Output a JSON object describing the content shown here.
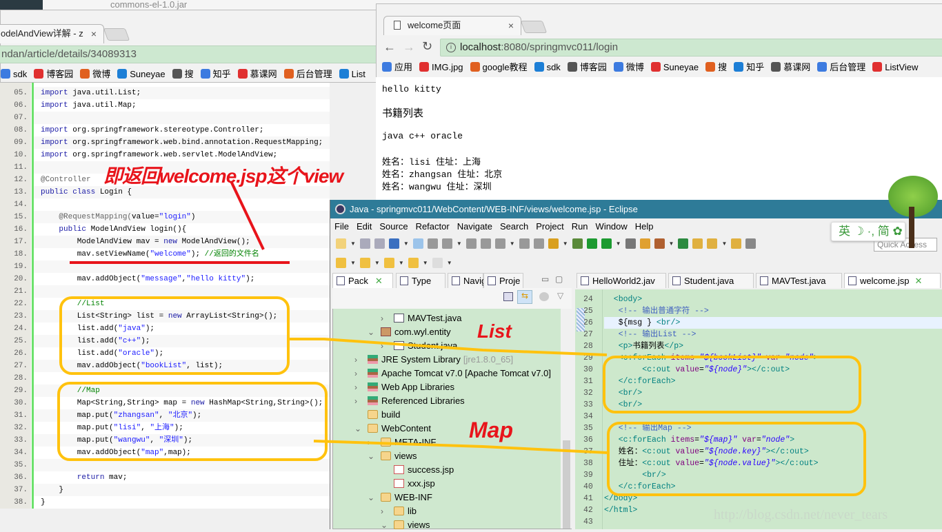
{
  "explorer_strip": {
    "title": "commons-el-1.0.jar"
  },
  "left_browser": {
    "tab_title": "odelAndView详解 - z",
    "tab_close": "×",
    "url": "ndan/article/details/34089313",
    "bookmarks": [
      "sdk",
      "博客园",
      "微博",
      "Suneyae",
      "搜",
      "知乎",
      "慕课网",
      "后台管理",
      "List"
    ]
  },
  "code": {
    "lines": [
      {
        "n": "05.",
        "seg": [
          [
            "import",
            "k"
          ],
          [
            " java.util.List;",
            ""
          ]
        ]
      },
      {
        "n": "06.",
        "seg": [
          [
            "import",
            "k"
          ],
          [
            " java.util.Map;",
            ""
          ]
        ]
      },
      {
        "n": "07.",
        "seg": []
      },
      {
        "n": "08.",
        "seg": [
          [
            "import",
            "k"
          ],
          [
            " org.springframework.stereotype.Controller;",
            ""
          ]
        ]
      },
      {
        "n": "09.",
        "seg": [
          [
            "import",
            "k"
          ],
          [
            " org.springframework.web.bind.annotation.RequestMapping;",
            ""
          ]
        ]
      },
      {
        "n": "10.",
        "seg": [
          [
            "import",
            "k"
          ],
          [
            " org.springframework.web.servlet.ModelAndView;",
            ""
          ]
        ]
      },
      {
        "n": "11.",
        "seg": []
      },
      {
        "n": "12.",
        "seg": [
          [
            "@Controller",
            "a"
          ]
        ]
      },
      {
        "n": "13.",
        "seg": [
          [
            "public class",
            "k"
          ],
          [
            " Login {",
            ""
          ]
        ]
      },
      {
        "n": "14.",
        "seg": []
      },
      {
        "n": "15.",
        "seg": [
          [
            "    @RequestMapping(",
            "a"
          ],
          [
            "value=",
            ""
          ],
          [
            "\"login\"",
            "s"
          ],
          [
            ")",
            ""
          ]
        ]
      },
      {
        "n": "16.",
        "seg": [
          [
            "    public",
            "k"
          ],
          [
            " ModelAndView login(){",
            ""
          ]
        ]
      },
      {
        "n": "17.",
        "seg": [
          [
            "        ModelAndView mav = ",
            ""
          ],
          [
            "new",
            "k"
          ],
          [
            " ModelAndView();",
            ""
          ]
        ]
      },
      {
        "n": "18.",
        "seg": [
          [
            "        mav.setViewName(",
            ""
          ],
          [
            "\"welcome\"",
            "s"
          ],
          [
            "); ",
            ""
          ],
          [
            "//返回的文件名",
            "c"
          ]
        ]
      },
      {
        "n": "19.",
        "seg": []
      },
      {
        "n": "20.",
        "seg": [
          [
            "        mav.addObject(",
            ""
          ],
          [
            "\"message\"",
            "s"
          ],
          [
            ",",
            ""
          ],
          [
            "\"hello kitty\"",
            "s"
          ],
          [
            ");",
            ""
          ]
        ]
      },
      {
        "n": "21.",
        "seg": []
      },
      {
        "n": "22.",
        "seg": [
          [
            "        //List",
            "c"
          ]
        ]
      },
      {
        "n": "23.",
        "seg": [
          [
            "        List<String> list = ",
            ""
          ],
          [
            "new",
            "k"
          ],
          [
            " ArrayList<String>();",
            ""
          ]
        ]
      },
      {
        "n": "24.",
        "seg": [
          [
            "        list.add(",
            ""
          ],
          [
            "\"java\"",
            "s"
          ],
          [
            ");",
            ""
          ]
        ]
      },
      {
        "n": "25.",
        "seg": [
          [
            "        list.add(",
            ""
          ],
          [
            "\"c++\"",
            "s"
          ],
          [
            ");",
            ""
          ]
        ]
      },
      {
        "n": "26.",
        "seg": [
          [
            "        list.add(",
            ""
          ],
          [
            "\"oracle\"",
            "s"
          ],
          [
            ");",
            ""
          ]
        ]
      },
      {
        "n": "27.",
        "seg": [
          [
            "        mav.addObject(",
            ""
          ],
          [
            "\"bookList\"",
            "s"
          ],
          [
            ", list);",
            ""
          ]
        ]
      },
      {
        "n": "28.",
        "seg": []
      },
      {
        "n": "29.",
        "seg": [
          [
            "        //Map",
            "c"
          ]
        ]
      },
      {
        "n": "30.",
        "seg": [
          [
            "        Map<String,String> map = ",
            ""
          ],
          [
            "new",
            "k"
          ],
          [
            " HashMap<String,String>();",
            ""
          ]
        ]
      },
      {
        "n": "31.",
        "seg": [
          [
            "        map.put(",
            ""
          ],
          [
            "\"zhangsan\"",
            "s"
          ],
          [
            ", ",
            ""
          ],
          [
            "\"北京\"",
            "s"
          ],
          [
            ");",
            ""
          ]
        ]
      },
      {
        "n": "32.",
        "seg": [
          [
            "        map.put(",
            ""
          ],
          [
            "\"lisi\"",
            "s"
          ],
          [
            ", ",
            ""
          ],
          [
            "\"上海\"",
            "s"
          ],
          [
            ");",
            ""
          ]
        ]
      },
      {
        "n": "33.",
        "seg": [
          [
            "        map.put(",
            ""
          ],
          [
            "\"wangwu\"",
            "s"
          ],
          [
            ", ",
            ""
          ],
          [
            "\"深圳\"",
            "s"
          ],
          [
            ");",
            ""
          ]
        ]
      },
      {
        "n": "34.",
        "seg": [
          [
            "        mav.addObject(",
            ""
          ],
          [
            "\"map\"",
            "s"
          ],
          [
            ",map);",
            ""
          ]
        ]
      },
      {
        "n": "35.",
        "seg": []
      },
      {
        "n": "36.",
        "seg": [
          [
            "        return",
            "k"
          ],
          [
            " mav;",
            ""
          ]
        ]
      },
      {
        "n": "37.",
        "seg": [
          [
            "    }",
            ""
          ]
        ]
      },
      {
        "n": "38.",
        "seg": [
          [
            "}",
            ""
          ]
        ]
      }
    ]
  },
  "right_browser": {
    "tab_title": "welcome页面",
    "tab_close": "×",
    "url_host": "localhost",
    "url_rest": ":8080/springmvc011/login",
    "bookmarks": [
      "应用",
      "IMG.jpg",
      "google教程",
      "sdk",
      "博客园",
      "微博",
      "Suneyae",
      "搜",
      "知乎",
      "慕课网",
      "后台管理",
      "ListView"
    ],
    "content": {
      "message": "hello kitty",
      "book_heading": "书籍列表",
      "books": "java c++ oracle",
      "people": [
        "姓名：lisi 住址：上海",
        "姓名：zhangsan 住址：北京",
        "姓名：wangwu 住址：深圳"
      ]
    }
  },
  "eclipse": {
    "title": "Java - springmvc011/WebContent/WEB-INF/views/welcome.jsp - Eclipse",
    "menu": [
      "File",
      "Edit",
      "Source",
      "Refactor",
      "Navigate",
      "Search",
      "Project",
      "Run",
      "Window",
      "Help"
    ],
    "quick_access": "Quick Access",
    "view_tabs": [
      "Pack",
      "Type",
      "Navig",
      "Proje"
    ],
    "editor_tabs": [
      "HelloWorld2.jav",
      "Student.java",
      "MAVTest.java",
      "welcome.jsp"
    ],
    "tree": [
      {
        "level": 3,
        "arrow": "›",
        "icon": "jfile",
        "label": "MAVTest.java"
      },
      {
        "level": 2,
        "arrow": "⌄",
        "icon": "pkgi",
        "label": "com.wyl.entity"
      },
      {
        "level": 3,
        "arrow": "›",
        "icon": "jfile",
        "label": "Student.java"
      },
      {
        "level": 1,
        "arrow": "›",
        "icon": "lib",
        "label": "JRE System Library",
        "extra": "[jre1.8.0_65]"
      },
      {
        "level": 1,
        "arrow": "›",
        "icon": "lib",
        "label": "Apache Tomcat v7.0 [Apache Tomcat v7.0]"
      },
      {
        "level": 1,
        "arrow": "›",
        "icon": "lib",
        "label": "Web App Libraries"
      },
      {
        "level": 1,
        "arrow": "›",
        "icon": "lib",
        "label": "Referenced Libraries"
      },
      {
        "level": 1,
        "arrow": "",
        "icon": "folder",
        "label": "build"
      },
      {
        "level": 1,
        "arrow": "⌄",
        "icon": "folder",
        "label": "WebContent"
      },
      {
        "level": 2,
        "arrow": "›",
        "icon": "folder",
        "label": "META-INF"
      },
      {
        "level": 2,
        "arrow": "⌄",
        "icon": "folder",
        "label": "views"
      },
      {
        "level": 3,
        "arrow": "",
        "icon": "jsp",
        "label": "success.jsp"
      },
      {
        "level": 3,
        "arrow": "",
        "icon": "jsp",
        "label": "xxx.jsp"
      },
      {
        "level": 2,
        "arrow": "⌄",
        "icon": "folder",
        "label": "WEB-INF"
      },
      {
        "level": 3,
        "arrow": "›",
        "icon": "folder",
        "label": "lib"
      },
      {
        "level": 3,
        "arrow": "⌄",
        "icon": "folder",
        "label": "views"
      }
    ],
    "jsp_lines": [
      {
        "n": "23",
        "seg": []
      },
      {
        "n": "24",
        "seg": [
          [
            "  <body>",
            "t"
          ]
        ]
      },
      {
        "n": "25",
        "seg": [
          [
            "   <!-- ",
            "cm"
          ],
          [
            "输出普通字符",
            "cm"
          ],
          [
            " -->",
            "cm"
          ]
        ]
      },
      {
        "n": "26",
        "seg": [
          [
            "   ${msg } ",
            "tx"
          ],
          [
            "<br/>",
            "t"
          ]
        ],
        "hl": true
      },
      {
        "n": "27",
        "seg": [
          [
            "   <!-- ",
            "cm"
          ],
          [
            "输出List",
            "cm"
          ],
          [
            " -->",
            "cm"
          ]
        ]
      },
      {
        "n": "28",
        "seg": [
          [
            "   <p>",
            "t"
          ],
          [
            "书籍列表",
            "tx"
          ],
          [
            "</p>",
            "t"
          ]
        ]
      },
      {
        "n": "29",
        "seg": [
          [
            "   <c:forEach ",
            "t"
          ],
          [
            "items",
            "an"
          ],
          [
            "=",
            "tx"
          ],
          [
            "\"${bookList}\"",
            "av"
          ],
          [
            " var",
            "an"
          ],
          [
            "=",
            "tx"
          ],
          [
            "\"node\"",
            "av"
          ],
          [
            ">",
            "t"
          ]
        ]
      },
      {
        "n": "30",
        "seg": [
          [
            "        <c:out ",
            "t"
          ],
          [
            "value",
            "an"
          ],
          [
            "=",
            "tx"
          ],
          [
            "\"${node}\"",
            "av"
          ],
          [
            "></c:out>",
            "t"
          ]
        ]
      },
      {
        "n": "31",
        "seg": [
          [
            "   </c:forEach>",
            "t"
          ]
        ]
      },
      {
        "n": "32",
        "seg": [
          [
            "   <br/>",
            "t"
          ]
        ]
      },
      {
        "n": "33",
        "seg": [
          [
            "   <br/>",
            "t"
          ]
        ]
      },
      {
        "n": "34",
        "seg": []
      },
      {
        "n": "35",
        "seg": [
          [
            "   <!-- ",
            "cm"
          ],
          [
            "输出Map",
            "cm"
          ],
          [
            " -->",
            "cm"
          ]
        ]
      },
      {
        "n": "36",
        "seg": [
          [
            "   <c:forEach ",
            "t"
          ],
          [
            "items",
            "an"
          ],
          [
            "=",
            "tx"
          ],
          [
            "\"${map}\"",
            "av"
          ],
          [
            " var",
            "an"
          ],
          [
            "=",
            "tx"
          ],
          [
            "\"node\"",
            "av"
          ],
          [
            ">",
            "t"
          ]
        ]
      },
      {
        "n": "37",
        "seg": [
          [
            "   姓名：",
            "tx"
          ],
          [
            "<c:out ",
            "t"
          ],
          [
            "value",
            "an"
          ],
          [
            "=",
            "tx"
          ],
          [
            "\"${node.key}\"",
            "av"
          ],
          [
            "></c:out>",
            "t"
          ]
        ]
      },
      {
        "n": "38",
        "seg": [
          [
            "   住址：",
            "tx"
          ],
          [
            "<c:out ",
            "t"
          ],
          [
            "value",
            "an"
          ],
          [
            "=",
            "tx"
          ],
          [
            "\"${node.value}\"",
            "av"
          ],
          [
            "></c:out>",
            "t"
          ]
        ]
      },
      {
        "n": "39",
        "seg": [
          [
            "        <br/>",
            "t"
          ]
        ]
      },
      {
        "n": "40",
        "seg": [
          [
            "   </c:forEach>",
            "t"
          ]
        ]
      },
      {
        "n": "41",
        "seg": [
          [
            "</body>",
            "t"
          ]
        ]
      },
      {
        "n": "42",
        "seg": [
          [
            "</html>",
            "t"
          ]
        ]
      },
      {
        "n": "43",
        "seg": []
      }
    ]
  },
  "ime": {
    "label": "英 ☽ ·, 简 ✿"
  },
  "annotations": {
    "view_note": "即返回welcome.jsp这个view",
    "list_label": "List",
    "map_label": "Map",
    "red": "#e8141b",
    "yellow": "#ffc20e"
  },
  "watermark": "http://blog.csdn.net/never_tears"
}
